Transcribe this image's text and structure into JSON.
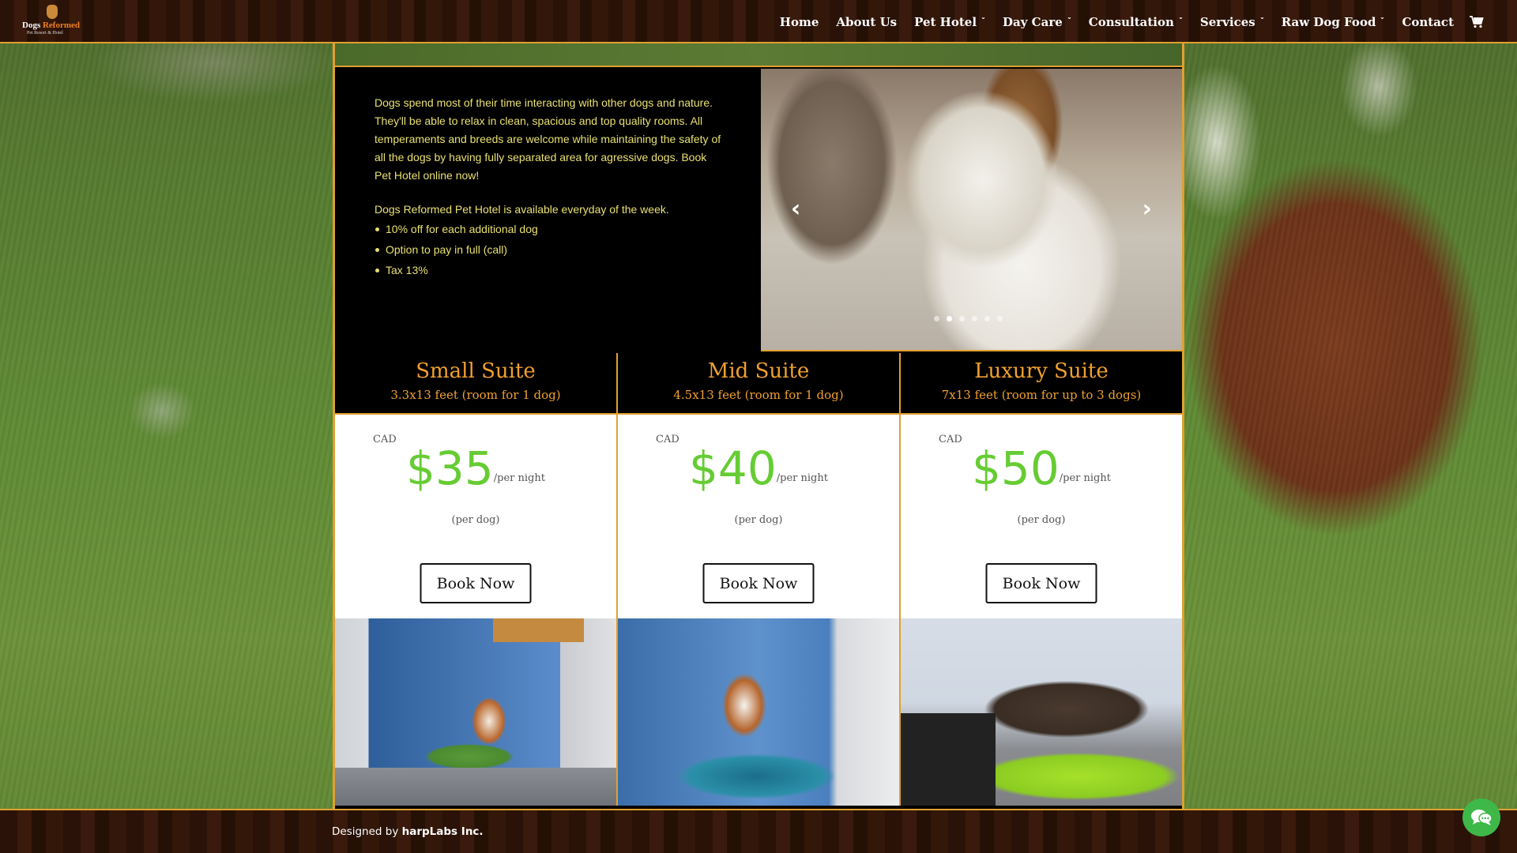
{
  "brand": {
    "logo_line1_a": "Dogs ",
    "logo_line1_b": "Reformed",
    "logo_line2": "Pet Resort & Hotel"
  },
  "nav": {
    "items": [
      {
        "label": "Home",
        "has_dropdown": false
      },
      {
        "label": "About Us",
        "has_dropdown": false
      },
      {
        "label": "Pet Hotel",
        "has_dropdown": true
      },
      {
        "label": "Day Care",
        "has_dropdown": true
      },
      {
        "label": "Consultation",
        "has_dropdown": true
      },
      {
        "label": "Services",
        "has_dropdown": true
      },
      {
        "label": "Raw Dog Food",
        "has_dropdown": true
      },
      {
        "label": "Contact",
        "has_dropdown": false
      }
    ],
    "dropdown_glyph": "˅",
    "cart_icon": "shopping-cart-icon"
  },
  "intro": {
    "paragraph": "Dogs spend most of their time interacting with other dogs and nature. They'll be able to relax in clean, spacious and top quality rooms. All temperaments and breeds are welcome while maintaining the safety of all the dogs by having fully separated area for agressive dogs. Book Pet Hotel online now!",
    "availability": "Dogs Reformed Pet Hotel is available everyday of the week.",
    "bullets": [
      "10% off for each additional dog",
      "Option to pay in full (call)",
      "Tax 13%"
    ]
  },
  "slider": {
    "prev_glyph": "‹",
    "next_glyph": "›",
    "slide_count": 6,
    "active_index": 1
  },
  "suites": [
    {
      "title": "Small Suite",
      "subtitle": "3.3x13 feet (room for 1 dog)",
      "currency": "CAD",
      "price": "$35",
      "per": "/per night",
      "note": "(per dog)",
      "cta": "Book Now"
    },
    {
      "title": "Mid Suite",
      "subtitle": "4.5x13 feet (room for 1 dog)",
      "currency": "CAD",
      "price": "$40",
      "per": "/per night",
      "note": "(per dog)",
      "cta": "Book Now"
    },
    {
      "title": "Luxury Suite",
      "subtitle": "7x13 feet (room for up to 3 dogs)",
      "currency": "CAD",
      "price": "$50",
      "per": "/per night",
      "note": "(per dog)",
      "cta": "Book Now"
    }
  ],
  "footer": {
    "credit_prefix": "Designed by ",
    "credit_company": "harpLabs Inc."
  },
  "chat": {
    "icon": "chat-bubbles-icon"
  },
  "colors": {
    "accent_orange": "#e0a030",
    "intro_text": "#e8e070",
    "price_green": "#66cc33",
    "chat_green": "#3eb849"
  }
}
